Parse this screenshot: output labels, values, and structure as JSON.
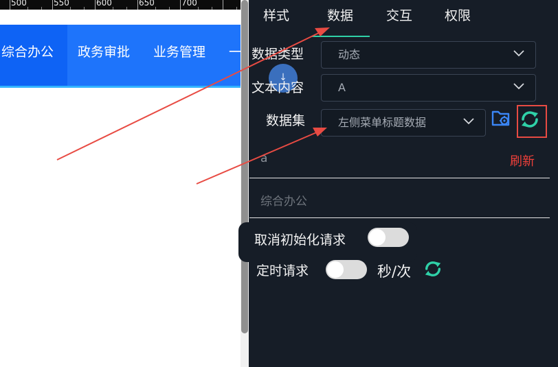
{
  "ruler": {
    "labels": [
      "500",
      "550",
      "600",
      "650",
      "700"
    ]
  },
  "nav": {
    "items": [
      "综合办公",
      "政务审批",
      "业务管理",
      "一"
    ]
  },
  "avatar_glyph": "↓",
  "tabs": [
    "样式",
    "数据",
    "交互",
    "权限"
  ],
  "active_tab": "数据",
  "fields": {
    "data_type": {
      "label": "数据类型",
      "value": "动态"
    },
    "text_content": {
      "label": "文本内容",
      "value": "A"
    },
    "dataset": {
      "label": "数据集",
      "value": "左侧菜单标题数据"
    }
  },
  "data_preview": {
    "key": "a",
    "refresh_label": "刷新",
    "value": "综合办公"
  },
  "options": {
    "cancel_init": {
      "label": "取消初始化请求",
      "on": false
    },
    "timed_request": {
      "label": "定时请求",
      "on": false,
      "unit": "秒/次"
    }
  },
  "colors": {
    "accent": "#2fd1a8",
    "annotation": "#e84b43",
    "panel_bg": "#161d27",
    "nav_blue": "#1e74fb",
    "icon_blue": "#3b86f6"
  },
  "icons": {
    "dataset_settings": "folder-gear-icon",
    "dataset_refresh": "refresh-icon",
    "timed_refresh": "refresh-icon",
    "select_dropdown": "chevron-down-icon"
  }
}
